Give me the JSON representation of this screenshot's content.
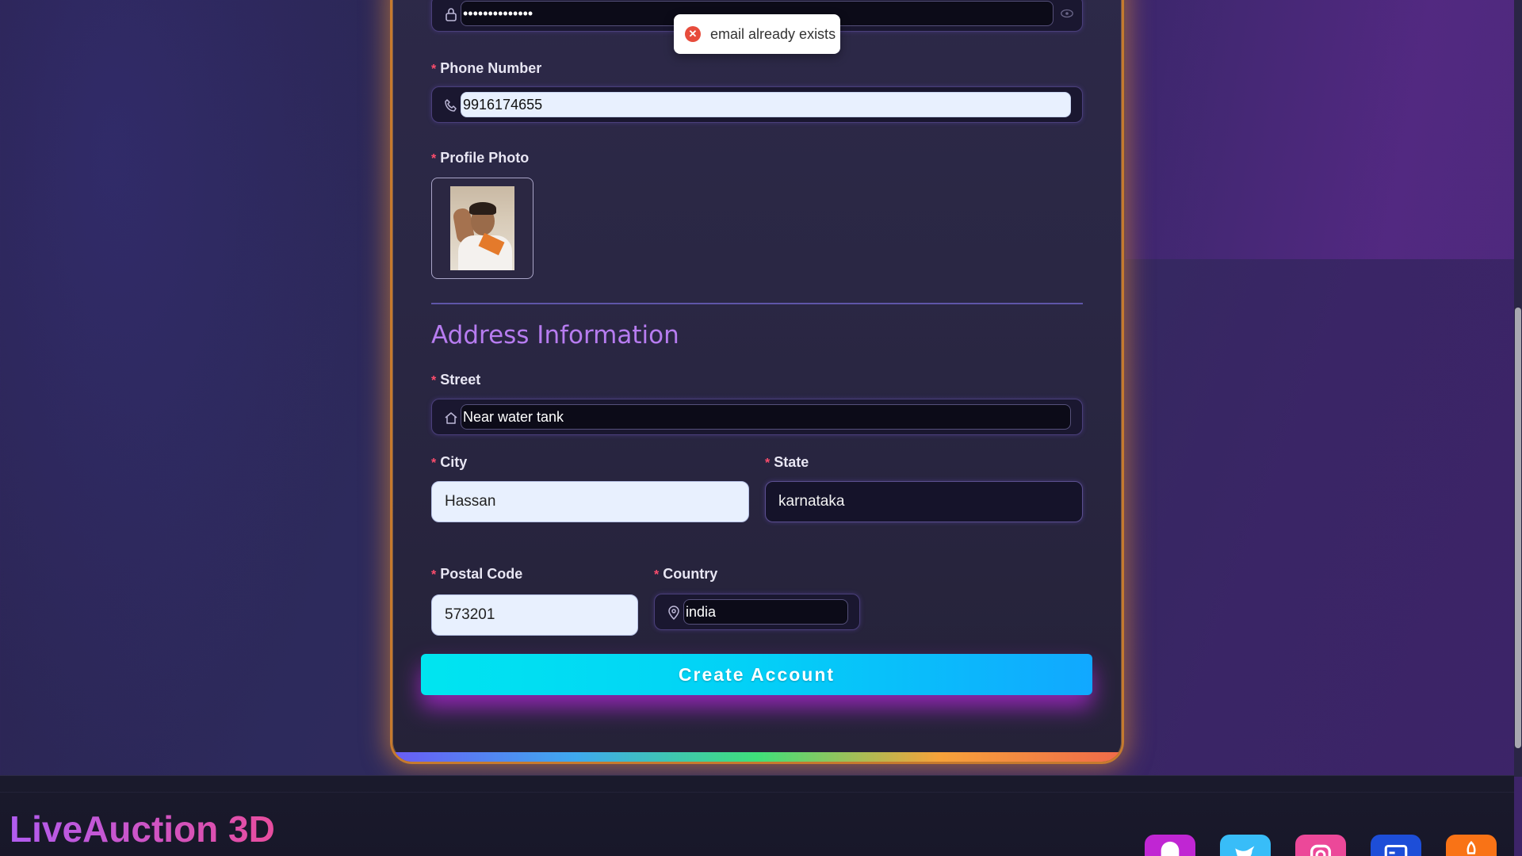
{
  "form": {
    "password_value": "••••••••••••••",
    "phone_label": "Phone Number",
    "phone_value": "9916174655",
    "photo_label": "Profile Photo",
    "address_title": "Address Information",
    "street_label": "Street",
    "street_value": "Near water tank",
    "city_label": "City",
    "city_value": "Hassan",
    "state_label": "State",
    "state_value": "karnataka",
    "postal_label": "Postal Code",
    "postal_value": "573201",
    "country_label": "Country",
    "country_value": "india",
    "required_marker": "*",
    "submit_label": "Create Account"
  },
  "toast": {
    "message": "email already exists",
    "icon": "x-icon",
    "type": "error"
  },
  "footer": {
    "brand": "LiveAuction 3D",
    "social": [
      {
        "name": "github-icon",
        "color": "#c026d3"
      },
      {
        "name": "twitter-icon",
        "color": "#38bdf8"
      },
      {
        "name": "instagram-icon",
        "color": "#ec4899"
      },
      {
        "name": "browser-icon",
        "color": "#1d4ed8"
      },
      {
        "name": "rocket-icon",
        "color": "#f97316"
      }
    ]
  },
  "colors": {
    "accent_purple": "#b77cf0",
    "required": "#ff4d6d",
    "button_start": "#00e5f0",
    "button_end": "#11a8ff",
    "card_border": "#c67a2e"
  }
}
